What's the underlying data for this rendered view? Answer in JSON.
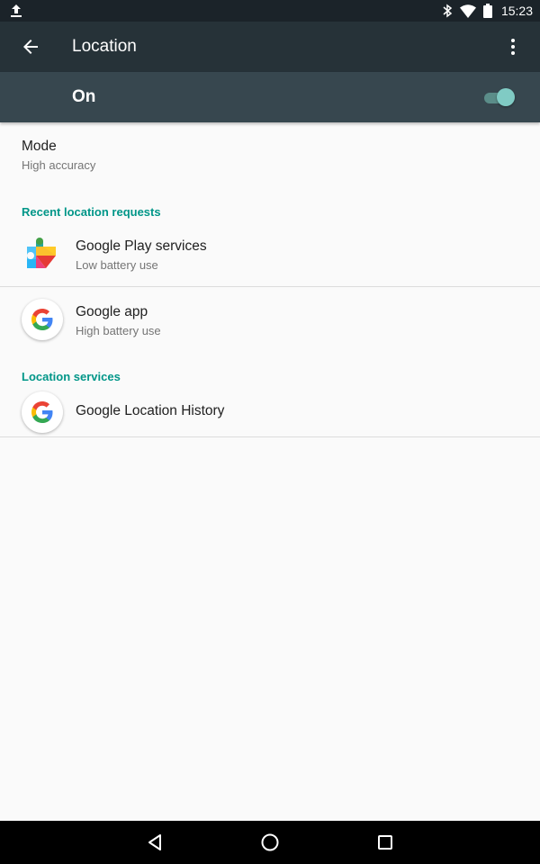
{
  "status_bar": {
    "time": "15:23",
    "icons": [
      "upload-icon",
      "bluetooth-icon",
      "wifi-icon",
      "battery-icon"
    ]
  },
  "app_bar": {
    "title": "Location",
    "back_icon": "arrow-back-icon",
    "menu_icon": "more-vert-icon"
  },
  "master_switch": {
    "label": "On",
    "checked": true,
    "accent_color": "#80cbc4"
  },
  "mode": {
    "title": "Mode",
    "value": "High accuracy"
  },
  "recent_requests": {
    "header": "Recent location requests",
    "items": [
      {
        "name": "Google Play services",
        "usage": "Low battery use",
        "icon": "google-play-services-icon"
      },
      {
        "name": "Google app",
        "usage": "High battery use",
        "icon": "google-g-icon"
      }
    ]
  },
  "location_services": {
    "header": "Location services",
    "items": [
      {
        "name": "Google Location History",
        "icon": "google-g-icon"
      }
    ]
  },
  "colors": {
    "status_bar": "#1b2329",
    "app_bar": "#263238",
    "switch_bar": "#37474f",
    "accent": "#009688",
    "background": "#fafafa"
  },
  "nav_bar": {
    "buttons": [
      "back-triangle-icon",
      "home-circle-icon",
      "recents-square-icon"
    ]
  }
}
